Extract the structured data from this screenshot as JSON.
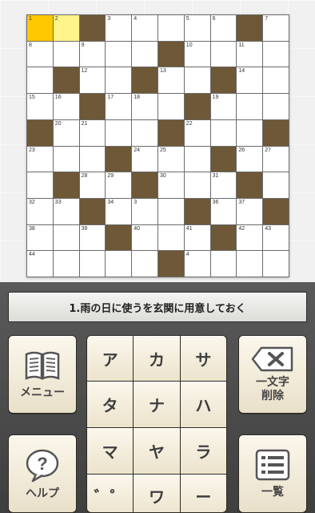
{
  "clue": {
    "text": "1.雨の日に使うを玄関に用意しておく"
  },
  "grid": {
    "rows": [
      [
        "1",
        "2",
        "#",
        "3",
        "4",
        "",
        "5",
        "6",
        "#",
        "7"
      ],
      [
        "8",
        "",
        "9",
        "",
        "",
        "#",
        "10",
        "",
        "11",
        ""
      ],
      [
        "",
        "#",
        "12",
        "",
        "#",
        "13",
        "",
        "#",
        "14",
        ""
      ],
      [
        "15",
        "16",
        "#",
        "17",
        "18",
        "",
        "#",
        "19",
        "",
        ""
      ],
      [
        "#",
        "20",
        "21",
        "",
        "",
        "#",
        "22",
        "",
        "",
        "#"
      ],
      [
        "23",
        "",
        "",
        "#",
        "24",
        "25",
        "",
        "#",
        "26",
        "27"
      ],
      [
        "",
        "#",
        "28",
        "29",
        "#",
        "30",
        "",
        "31",
        "#",
        ""
      ],
      [
        "32",
        "33",
        "#",
        "34",
        "3",
        "",
        "#",
        "36",
        "37",
        "#"
      ],
      [
        "38",
        "",
        "39",
        "#",
        "40",
        "",
        "41",
        "#",
        "42",
        "43"
      ],
      [
        "44",
        "",
        "",
        "",
        "",
        "#",
        "4",
        "",
        "",
        ""
      ]
    ],
    "selected": [
      0,
      0
    ],
    "highlight": [
      [
        0,
        1
      ]
    ]
  },
  "buttons": {
    "menu": "メニュー",
    "help": "ヘルプ",
    "delete_line1": "一文字",
    "delete_line2": "削除",
    "list": "一覧"
  },
  "keypad": {
    "keys": [
      "ア",
      "カ",
      "サ",
      "タ",
      "ナ",
      "ハ",
      "マ",
      "ヤ",
      "ラ",
      "゛゜",
      "ワ",
      "ー"
    ]
  }
}
